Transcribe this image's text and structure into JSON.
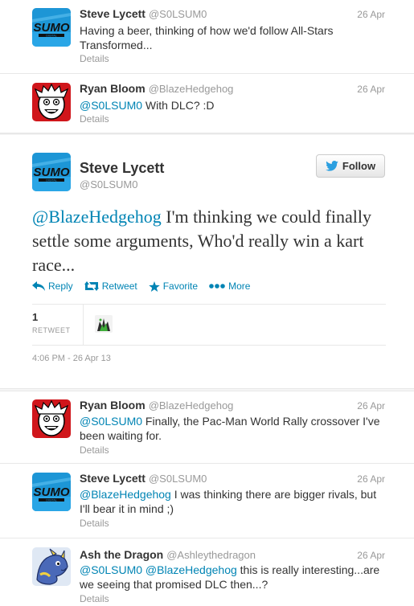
{
  "tweets_top": [
    {
      "name": "Steve Lycett",
      "screen_name": "@S0LSUM0",
      "date": "26 Apr",
      "text": "Having a beer, thinking of how we'd follow All-Stars Transformed...",
      "details": "Details",
      "avatar": "sumo-digital-logo"
    },
    {
      "name": "Ryan Bloom",
      "screen_name": "@BlazeHedgehog",
      "date": "26 Apr",
      "mention": "@S0LSUM0",
      "text": " With DLC? :D",
      "details": "Details",
      "avatar": "cartoon-face-avatar"
    }
  ],
  "main_tweet": {
    "name": "Steve Lycett",
    "screen_name": "@S0LSUM0",
    "follow_label": "Follow",
    "mention": "@BlazeHedgehog",
    "text": " I'm thinking we could finally settle some arguments, Who'd really win a kart race...",
    "actions": {
      "reply": "Reply",
      "retweet": "Retweet",
      "favorite": "Favorite",
      "more": "More"
    },
    "retweet_count": "1",
    "retweet_label": "RETWEET",
    "timestamp": "4:06 PM - 26 Apr 13"
  },
  "replies": [
    {
      "name": "Ryan Bloom",
      "screen_name": "@BlazeHedgehog",
      "date": "26 Apr",
      "mention": "@S0LSUM0",
      "text": " Finally, the Pac-Man World Rally crossover I've been waiting for.",
      "details": "Details"
    },
    {
      "name": "Steve Lycett",
      "screen_name": "@S0LSUM0",
      "date": "26 Apr",
      "mention": "@BlazeHedgehog",
      "text": " I was thinking there are bigger rivals, but I'll bear it in mind ;)",
      "details": "Details"
    },
    {
      "name": "Ash the Dragon",
      "screen_name": "@Ashleythedragon",
      "date": "26 Apr",
      "mention": "@S0LSUM0",
      "mention2": "@BlazeHedgehog",
      "text": " this is really interesting...are we seeing that promised DLC then...?",
      "details": "Details"
    }
  ],
  "colors": {
    "link": "#0084b4",
    "muted": "#999999",
    "text": "#333333"
  }
}
